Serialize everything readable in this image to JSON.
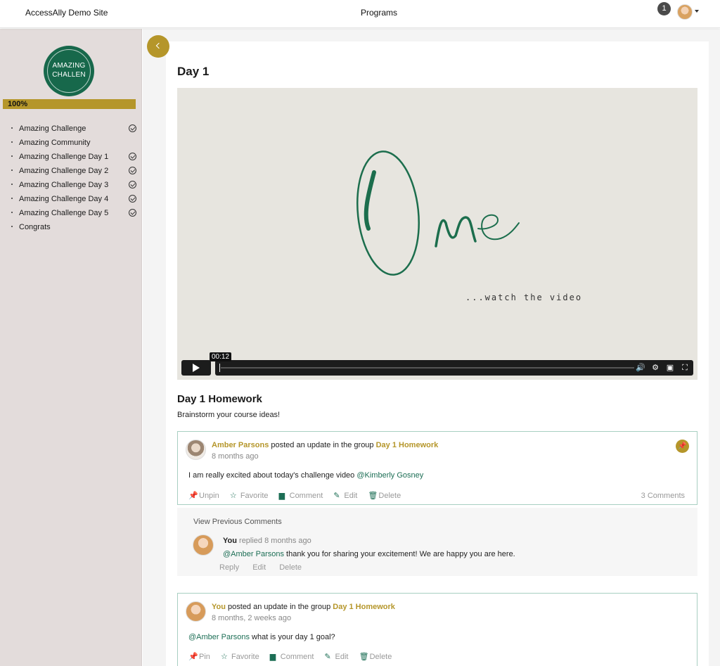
{
  "header": {
    "site_name": "AccessAlly Demo Site",
    "nav_label": "Programs",
    "notification_count": "1"
  },
  "sidebar": {
    "logo_text_line1": "AMAZING",
    "logo_text_line2": "CHALLEN",
    "progress_label": "100%",
    "progress_value": 100,
    "items": [
      {
        "label": "Amazing Challenge",
        "completed": true
      },
      {
        "label": "Amazing Community",
        "completed": false
      },
      {
        "label": "Amazing Challenge Day 1",
        "completed": true
      },
      {
        "label": "Amazing Challenge Day 2",
        "completed": true
      },
      {
        "label": "Amazing Challenge Day 3",
        "completed": true
      },
      {
        "label": "Amazing Challenge Day 4",
        "completed": true
      },
      {
        "label": "Amazing Challenge Day 5",
        "completed": true
      },
      {
        "label": "Congrats",
        "completed": false
      }
    ]
  },
  "main": {
    "title": "Day 1",
    "video": {
      "watch_text": "...watch the video",
      "current_time": "00:12"
    },
    "homework_title": "Day 1 Homework",
    "homework_desc": "Brainstorm your course ideas!",
    "posts": [
      {
        "author": "Amber Parsons",
        "action": " posted an update in the group ",
        "group": "Day 1 Homework",
        "time": "8 months ago",
        "text": "I am really excited about today's challenge video ",
        "mention": "@Kimberly Gosney",
        "actions": [
          "Unpin",
          "Favorite",
          "Comment",
          "Edit",
          "Delete"
        ],
        "comments_count": "3 Comments"
      },
      {
        "author": "You",
        "action": " posted an update in the group ",
        "group": "Day 1 Homework",
        "time": "8 months, 2 weeks ago",
        "mention": "@Amber Parsons",
        "text": " what is your day 1 goal?",
        "actions": [
          "Pin",
          "Favorite",
          "Comment",
          "Edit",
          "Delete"
        ]
      }
    ],
    "comments": {
      "view_previous": "View Previous Comments",
      "reply": {
        "author": "You",
        "meta": " replied 8 months ago",
        "mention": "@Amber Parsons",
        "text": " thank you for sharing your excitement! We are happy you are here.",
        "actions": [
          "Reply",
          "Edit",
          "Delete"
        ]
      }
    }
  }
}
